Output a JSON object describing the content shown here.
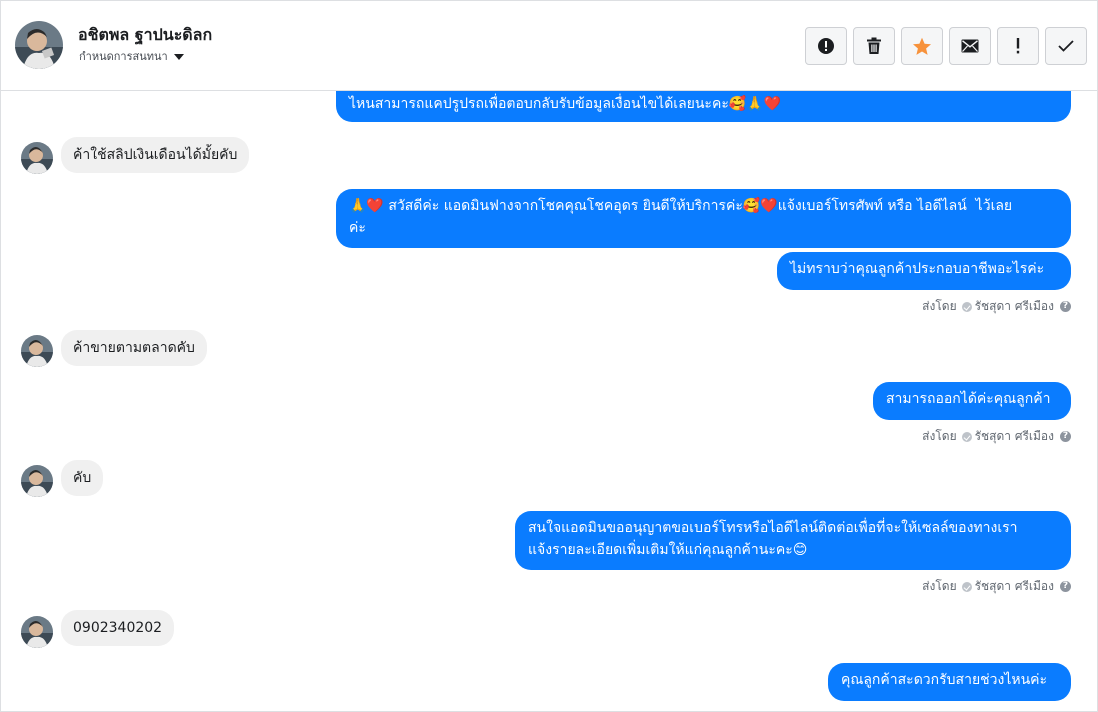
{
  "header": {
    "contact_name": "อชิตพล ฐาปนะดิลก",
    "label_select": "กำหนดการสนทนา",
    "actions": [
      {
        "name": "report-button",
        "icon": "alert-circle-icon"
      },
      {
        "name": "delete-button",
        "icon": "trash-icon"
      },
      {
        "name": "star-button",
        "icon": "star-icon",
        "color": "#f7923b"
      },
      {
        "name": "mark-unread-button",
        "icon": "envelope-icon"
      },
      {
        "name": "mark-important-button",
        "icon": "exclamation-icon"
      },
      {
        "name": "mark-done-button",
        "icon": "check-icon"
      }
    ]
  },
  "messages": {
    "m0": "ไหนสามารถแคปรูปรถเพื่อตอบกลับรับข้อมูลเงื่อนไขได้เลยนะคะ🥰🙏❤️",
    "m1": "ค้าใช้สลิปเงินเดือนได้มั้ยคับ",
    "m2": "🙏❤️ สวัสดีค่ะ แอดมินฟางจากโชคคุณโชคอุดร ยินดีให้บริการค่ะ🥰❤️แจ้งเบอร์โทรศัพท์ หรือ ไอดีไลน์  ไว้เลย\nค่ะ",
    "m3": "ไม่ทราบว่าคุณลูกค้าประกอบอาชีพอะไรค่ะ",
    "m4": "ค้าขายตามตลาดคับ",
    "m5": "สามารถออกได้ค่ะคุณลูกค้า",
    "m6": "คับ",
    "m7": "สนใจแอดมินขออนุญาตขอเบอร์โทรหรือไอดีไลน์ติดต่อเพื่อที่จะให้เซลล์ของทางเรา\nแจ้งรายละเอียดเพิ่มเติมให้แก่คุณลูกค้านะคะ😊",
    "m8": "0902340202",
    "m9": "คุณลูกค้าสะดวกรับสายช่วงไหนค่ะ"
  },
  "sent_by": {
    "prefix": "ส่งโดย",
    "agent": "รัชสุดา ศรีเมือง"
  },
  "colors": {
    "outgoing_bubble": "#0a7cff",
    "incoming_bubble": "#f0f0f0"
  }
}
